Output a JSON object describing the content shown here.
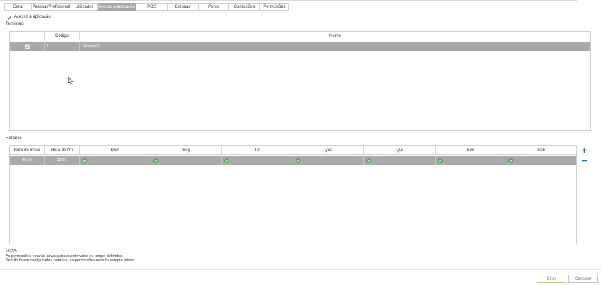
{
  "tabs": [
    {
      "label": "Geral",
      "active": false
    },
    {
      "label": "Pessoal/Profissional",
      "active": false
    },
    {
      "label": "Utilizador",
      "active": false
    },
    {
      "label": "Acesso à aplicação",
      "active": true
    },
    {
      "label": "POS",
      "active": false
    },
    {
      "label": "Colunas",
      "active": false
    },
    {
      "label": "Ponto",
      "active": false
    },
    {
      "label": "Comissões",
      "active": false
    },
    {
      "label": "Permissões",
      "active": false
    }
  ],
  "access": {
    "label": "Acesso à aplicação",
    "checked": true
  },
  "terminals": {
    "section_label": "Terminais",
    "columns": [
      "",
      "Código",
      "Nome"
    ],
    "rows": [
      {
        "selected": true,
        "code": "1",
        "name": "Terminal 1"
      }
    ]
  },
  "schedules": {
    "section_label": "Horários",
    "columns": [
      "Hora de início",
      "Hora de fim",
      "Dom",
      "Seg",
      "Ter",
      "Qua",
      "Qui",
      "Sex",
      "Sáb"
    ],
    "rows": [
      {
        "start": "00:00",
        "end": "23:59",
        "days": [
          true,
          true,
          true,
          true,
          true,
          true,
          true
        ]
      }
    ]
  },
  "side_buttons": {
    "add": "plus-icon",
    "remove": "minus-icon"
  },
  "note": {
    "title": "NOTA:",
    "line1": "As permissões estarão ativas para os intervalos de tempo definidos.",
    "line2": "Se não forem configurados horários, as permissões estarão sempre ativas."
  },
  "buttons": {
    "create": "Criar",
    "cancel": "Cancelar"
  },
  "colors": {
    "active_tab": "#a7a7a7",
    "selected_row": "#a9a9a9",
    "ok_green": "#4caf50",
    "accent_blue": "#2f6db5",
    "create_text": "#6f8a2e"
  }
}
